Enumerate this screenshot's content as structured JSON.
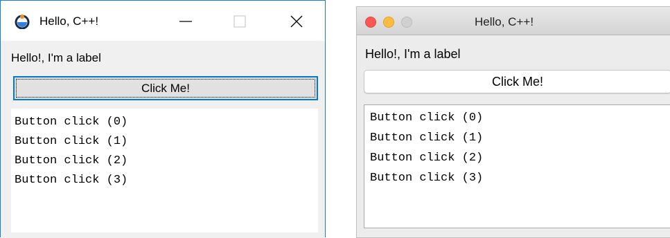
{
  "windows_window": {
    "title": "Hello, C++!",
    "app_icon": "app-logo-icon",
    "label": "Hello!, I'm a label",
    "button_label": "Click Me!",
    "output_lines": [
      "Button click (0)",
      "Button click (1)",
      "Button click (2)",
      "Button click (3)"
    ],
    "accent_color": "#0078d7"
  },
  "mac_window": {
    "title": "Hello, C++!",
    "label": "Hello!, I'm a label",
    "button_label": "Click Me!",
    "output_lines": [
      "Button click (0)",
      "Button click (1)",
      "Button click (2)",
      "Button click (3)"
    ],
    "traffic_light_colors": [
      "#fc5753",
      "#fdbc40",
      "#d0d0d0"
    ]
  }
}
